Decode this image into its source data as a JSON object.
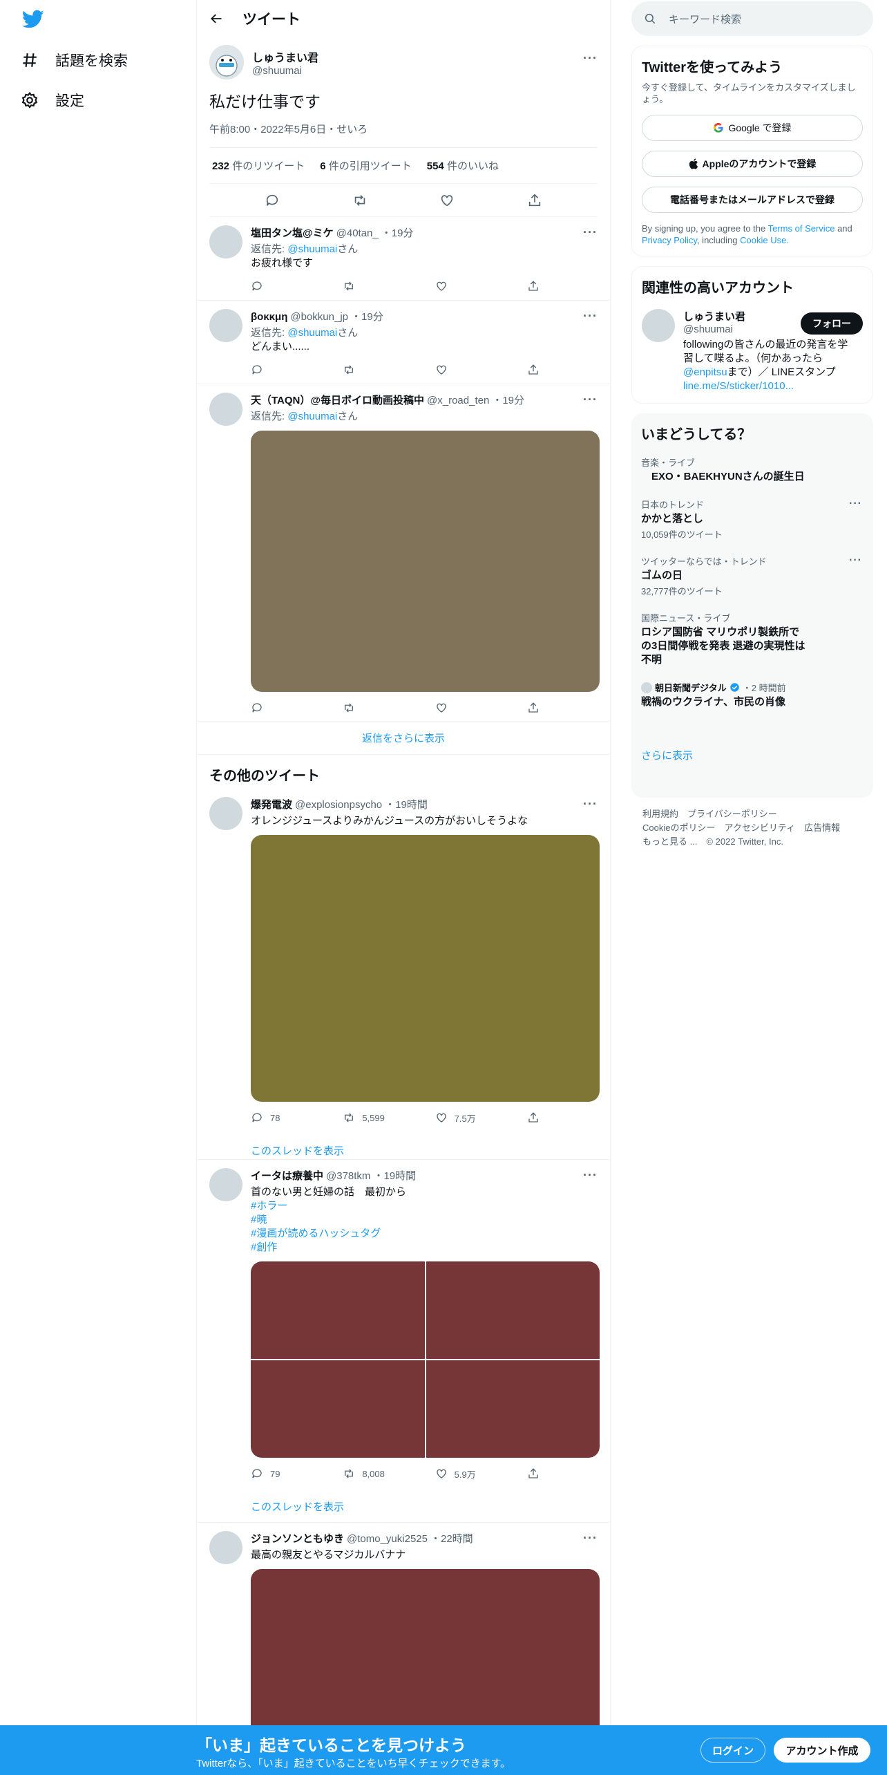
{
  "nav": {
    "explore_label": "話題を検索",
    "settings_label": "設定"
  },
  "header": {
    "title": "ツイート"
  },
  "focus_tweet": {
    "name": "しゅうまい君",
    "handle": "@shuumai",
    "text": "私だけ仕事です",
    "meta": "午前8:00・2022年5月6日・せいろ",
    "retweets_count": "232",
    "retweets_label": "件のリツイート",
    "quotes_count": "6",
    "quotes_label": "件の引用ツイート",
    "likes_count": "554",
    "likes_label": "件のいいね"
  },
  "replies": [
    {
      "name": "塩田タン塩@ミケ",
      "handle": "@40tan_",
      "time": "・19分",
      "reply_prefix": "返信先:",
      "reply_to": "@shuumai",
      "reply_suffix": "さん",
      "text": "お疲れ様です"
    },
    {
      "name": "βοκκμη",
      "handle": "@bokkun_jp",
      "time": "・19分",
      "reply_prefix": "返信先:",
      "reply_to": "@shuumai",
      "reply_suffix": "さん",
      "text": "どんまい......"
    },
    {
      "name": "天（TAQN）@毎日ボイロ動画投稿中",
      "handle": "@x_road_ten",
      "time": "・19分",
      "reply_prefix": "返信先:",
      "reply_to": "@shuumai",
      "reply_suffix": "さん",
      "media_color": "#81735a"
    }
  ],
  "more_replies_label": "返信をさらに表示",
  "other_tweets_title": "その他のツイート",
  "other_tweets": [
    {
      "name": "爆発電波",
      "handle": "@explosionpsycho",
      "time": "・19時間",
      "text": "オレンジジュースよりみかんジュースの方がおいしそうよな",
      "media_color": "#7f7534",
      "replies": "78",
      "retweets": "5,599",
      "likes": "7.5万",
      "thread_label": "このスレッドを表示"
    },
    {
      "name": "イータは療養中",
      "handle": "@378tkm",
      "time": "・19時間",
      "text": "首のない男と妊婦の話　最初から",
      "hashtags": [
        "#ホラー",
        "#暁",
        "#漫画が読めるハッシュタグ",
        "#創作"
      ],
      "media_color": "#763537",
      "replies": "79",
      "retweets": "8,008",
      "likes": "5.9万",
      "thread_label": "このスレッドを表示"
    },
    {
      "name": "ジョンソンともゆき",
      "handle": "@tomo_yuki2525",
      "time": "・22時間",
      "text": "最高の親友とやるマジカルバナナ",
      "media_color": "#763537"
    }
  ],
  "search": {
    "placeholder": "キーワード検索"
  },
  "signup": {
    "title": "Twitterを使ってみよう",
    "subtitle": "今すぐ登録して、タイムラインをカスタマイズしましょう。",
    "google_label": "Google で登録",
    "apple_label": "Appleのアカウントで登録",
    "phone_label": "電話番号またはメールアドレスで登録",
    "terms_prefix": "By signing up, you agree to the",
    "terms_link": "Terms of Service",
    "terms_and": "and",
    "privacy_link": "Privacy Policy",
    "terms_including": ", including",
    "cookie_link": "Cookie Use."
  },
  "relevant": {
    "title": "関連性の高いアカウント",
    "name": "しゅうまい君",
    "handle": "@shuumai",
    "follow_label": "フォロー",
    "bio_1": "followingの皆さんの最近の発言を学習して喋るよ。（何かあったら",
    "bio_mention": "@enpitsu",
    "bio_2": "まで）／ LINEスタンプ",
    "bio_link": "line.me/S/sticker/1010..."
  },
  "trends": {
    "title": "いまどうしてる？",
    "items": [
      {
        "category": "音楽・ライブ",
        "title": "　EXO・BAEKHYUNさんの誕生日",
        "count": ""
      },
      {
        "category": "日本のトレンド",
        "title": "かかと落とし",
        "count": "10,059件のツイート"
      },
      {
        "category": "ツイッターならでは・トレンド",
        "title": "ゴムの日",
        "count": "32,777件のツイート"
      },
      {
        "category": "国際ニュース・ライブ",
        "title": "ロシア国防省 マリウポリ製鉄所での3日間停戦を発表 退避の実現性は不明",
        "count": ""
      }
    ],
    "news_source": "朝日新聞デジタル",
    "news_time": "・2 時間前",
    "news_title": "戦禍のウクライナ、市民の肖像",
    "show_more": "さらに表示"
  },
  "footer": {
    "terms": "利用規約",
    "privacy": "プライバシーポリシー",
    "cookie": "Cookieのポリシー",
    "accessibility": "アクセシビリティ",
    "ads": "広告情報",
    "more": "もっと見る ...",
    "copyright": "© 2022 Twitter, Inc."
  },
  "bottom_bar": {
    "headline": "「いま」起きていることを見つけよう",
    "sub": "Twitterなら、「いま」起きていることをいち早くチェックできます。",
    "login_label": "ログイン",
    "signup_label": "アカウント作成"
  },
  "colors": {
    "accent": "#1d9bf0",
    "bottom_bar": "#1d9bf0",
    "text": "#0f1419",
    "muted": "#536471"
  }
}
